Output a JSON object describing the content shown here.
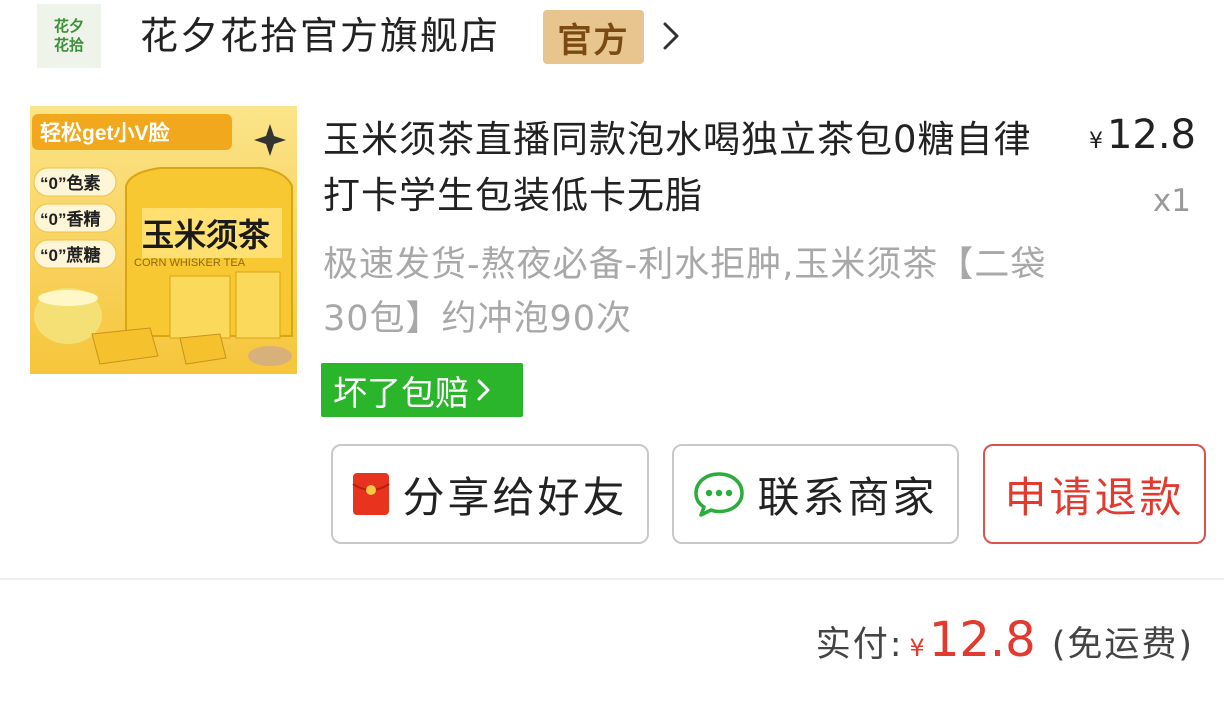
{
  "store": {
    "logo_line1": "花夕",
    "logo_line2": "花拾",
    "name": "花夕花拾官方旗舰店",
    "badge": "官方"
  },
  "product": {
    "image": {
      "banner": "轻松get小V脸",
      "claims": [
        "“0”色素",
        "“0”香精",
        "“0”蔗糖"
      ],
      "pack_title": "玉米须茶",
      "pack_sub": "CORN WHISKER TEA"
    },
    "title": "玉米须茶直播同款泡水喝独立茶包0糖自律打卡学生包装低卡无脂",
    "price_symbol": "¥",
    "price": "12.8",
    "quantity": "x1",
    "spec": "极速发货-熬夜必备-利水拒肿,玉米须茶【二袋30包】约冲泡90次",
    "guarantee": "坏了包赔"
  },
  "actions": {
    "share": "分享给好友",
    "contact": "联系商家",
    "refund": "申请退款"
  },
  "summary": {
    "label": "实付:",
    "symbol": "¥",
    "amount": "12.8",
    "note": "(免运费)"
  },
  "colors": {
    "accent_red": "#e33a2f",
    "guarantee_green": "#2ab52a",
    "official_badge": "#e8c58e",
    "wechat_green": "#2bad3c"
  },
  "icons": [
    "chevron-right-icon",
    "red-envelope-icon",
    "chat-bubble-icon"
  ]
}
